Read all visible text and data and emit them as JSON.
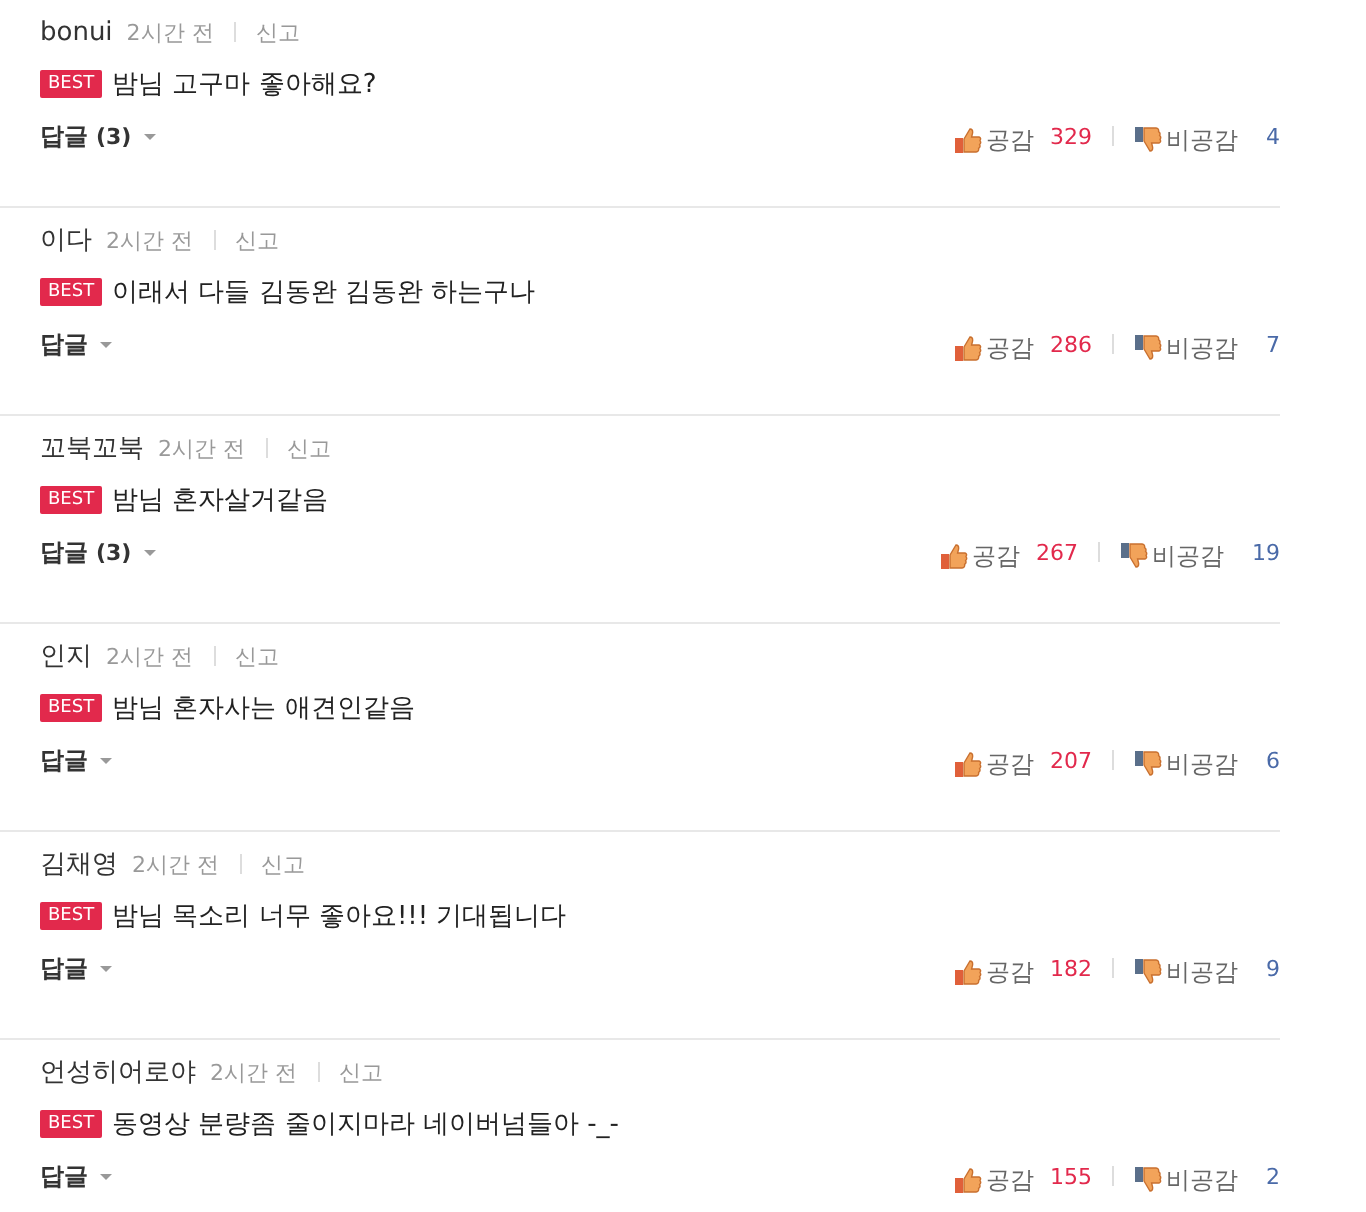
{
  "comments": [
    {
      "author": "bonui",
      "time": "2시간 전",
      "report": "신고",
      "badge": "BEST",
      "text": "밤님 고구마 좋아해요?",
      "reply_label": "답글",
      "reply_count": "(3)",
      "like_label": "공감",
      "likes": "329",
      "dislike_label": "비공감",
      "dislikes": "4"
    },
    {
      "author": "이다",
      "time": "2시간 전",
      "report": "신고",
      "badge": "BEST",
      "text": "이래서 다들 김동완 김동완 하는구나",
      "reply_label": "답글",
      "like_label": "공감",
      "likes": "286",
      "dislike_label": "비공감",
      "dislikes": "7"
    },
    {
      "author": "꼬북꼬북",
      "time": "2시간 전",
      "report": "신고",
      "badge": "BEST",
      "text": "밤님 혼자살거같음",
      "reply_label": "답글",
      "reply_count": "(3)",
      "like_label": "공감",
      "likes": "267",
      "dislike_label": "비공감",
      "dislikes": "19"
    },
    {
      "author": "인지",
      "time": "2시간 전",
      "report": "신고",
      "badge": "BEST",
      "text": "밤님 혼자사는 애견인같음",
      "reply_label": "답글",
      "like_label": "공감",
      "likes": "207",
      "dislike_label": "비공감",
      "dislikes": "6"
    },
    {
      "author": "김채영",
      "time": "2시간 전",
      "report": "신고",
      "badge": "BEST",
      "text": "밤님 목소리 너무 좋아요!!! 기대됩니다",
      "reply_label": "답글",
      "like_label": "공감",
      "likes": "182",
      "dislike_label": "비공감",
      "dislikes": "9"
    },
    {
      "author": "언성히어로야",
      "time": "2시간 전",
      "report": "신고",
      "badge": "BEST",
      "text": "동영상 분량좀 줄이지마라 네이버넘들아 -_-",
      "reply_label": "답글",
      "like_label": "공감",
      "likes": "155",
      "dislike_label": "비공감",
      "dislikes": "2"
    }
  ]
}
